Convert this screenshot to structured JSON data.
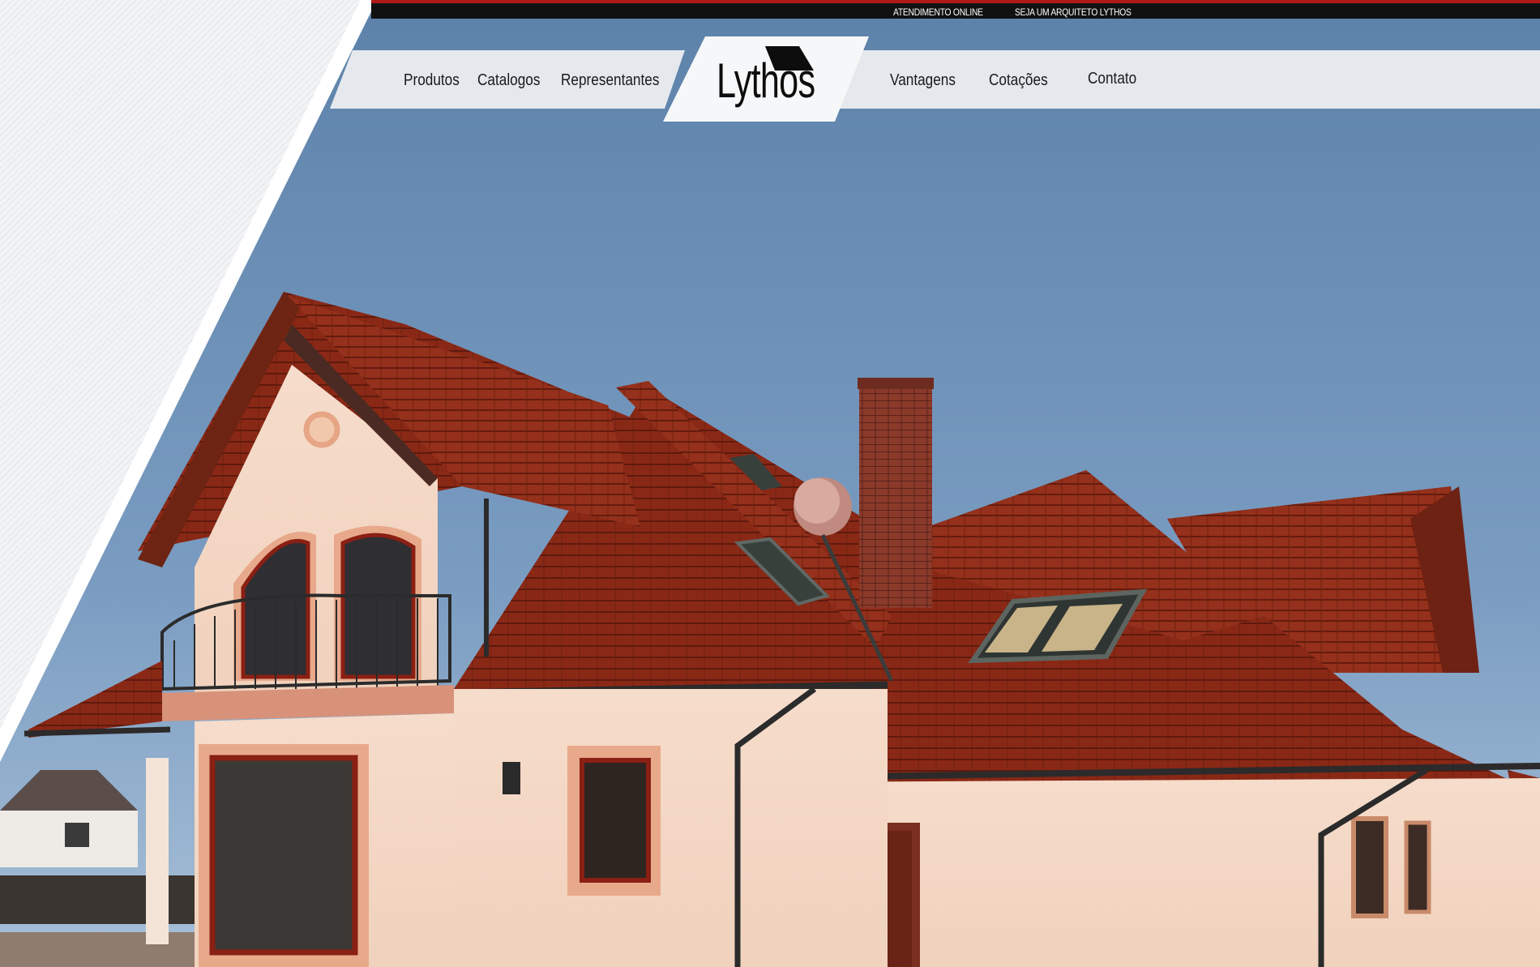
{
  "topbar": {
    "atendimento": "ATENDIMENTO ONLINE",
    "arquiteto": "SEJA UM ARQUITETO LYTHOS",
    "accent_color": "#b01818"
  },
  "nav": {
    "left": [
      "Produtos",
      "Catalogos",
      "Representantes"
    ],
    "right": [
      "Vantagens",
      "Cotações",
      "Contato"
    ]
  },
  "logo": {
    "text": "Lythos"
  },
  "hero": {
    "subject": "house with red tiled roof",
    "sky_color": "#6e90b4",
    "roof_color": "#8e2a17"
  }
}
